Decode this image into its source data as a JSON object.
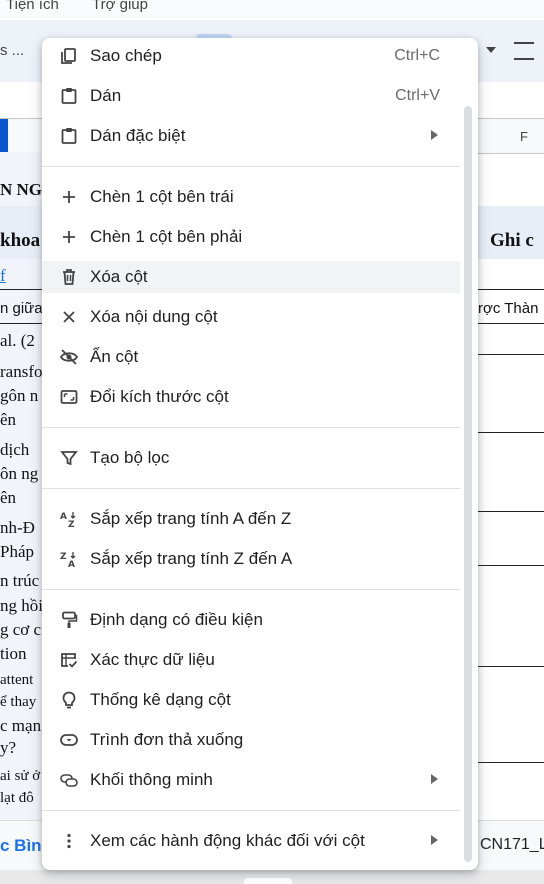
{
  "background": {
    "menubar": {
      "tienich": "Tiện ích",
      "trogiup": "Trợ giúp"
    },
    "toolbar": {
      "font_fragment": "s ..."
    },
    "column_header": {
      "f": "F"
    },
    "cells": {
      "title_fragment": "N NG",
      "header_khoa": "khoa",
      "header_ghichu": "Ghi c",
      "link_f": "f",
      "r1": "n giữa",
      "r1b": "rợc Thàn",
      "r2": "al. (2",
      "r3a": "ransfo",
      "r3b": "gôn n",
      "r3c": "ên",
      "r4a": "dịch",
      "r4b": "ôn ng",
      "r4c": "ên",
      "r5a": "nh-Đ",
      "r5b": "Pháp",
      "r6a": "n trúc",
      "r6b": "ng hồi",
      "r6c": "g cơ c",
      "r6d": "tion",
      "r7a": "attent",
      "r7b": "ể thay",
      "r7c": "c mạn",
      "r7d": "y?",
      "r8a": "ai sử ở",
      "r8b": "lạt đô"
    },
    "sheet_tabs": {
      "left": "c Bình",
      "right": "CN171_L"
    }
  },
  "menu": {
    "items": [
      {
        "label": "Sao chép",
        "shortcut": "Ctrl+C",
        "icon": "copy-icon"
      },
      {
        "label": "Dán",
        "shortcut": "Ctrl+V",
        "icon": "paste-icon"
      },
      {
        "label": "Dán đặc biệt",
        "icon": "paste-special-icon",
        "submenu": true
      },
      {
        "label": "Chèn 1 cột bên trái",
        "icon": "plus-icon"
      },
      {
        "label": "Chèn 1 cột bên phải",
        "icon": "plus-icon"
      },
      {
        "label": "Xóa cột",
        "icon": "trash-icon"
      },
      {
        "label": "Xóa nội dung cột",
        "icon": "close-icon"
      },
      {
        "label": "Ẩn cột",
        "icon": "eye-off-icon"
      },
      {
        "label": "Đổi kích thước cột",
        "icon": "resize-icon"
      },
      {
        "label": "Tạo bộ lọc",
        "icon": "filter-icon"
      },
      {
        "label": "Sắp xếp trang tính A đến Z",
        "icon": "sort-az-icon"
      },
      {
        "label": "Sắp xếp trang tính Z đến A",
        "icon": "sort-za-icon"
      },
      {
        "label": "Định dạng có điều kiện",
        "icon": "paint-roller-icon"
      },
      {
        "label": "Xác thực dữ liệu",
        "icon": "data-validation-icon"
      },
      {
        "label": "Thống kê dạng cột",
        "icon": "lightbulb-icon"
      },
      {
        "label": "Trình đơn thả xuống",
        "icon": "dropdown-icon"
      },
      {
        "label": "Khối thông minh",
        "icon": "smart-chips-icon",
        "submenu": true
      },
      {
        "label": "Xem các hành động khác đối với cột",
        "icon": "more-vert-icon",
        "submenu": true
      }
    ]
  }
}
